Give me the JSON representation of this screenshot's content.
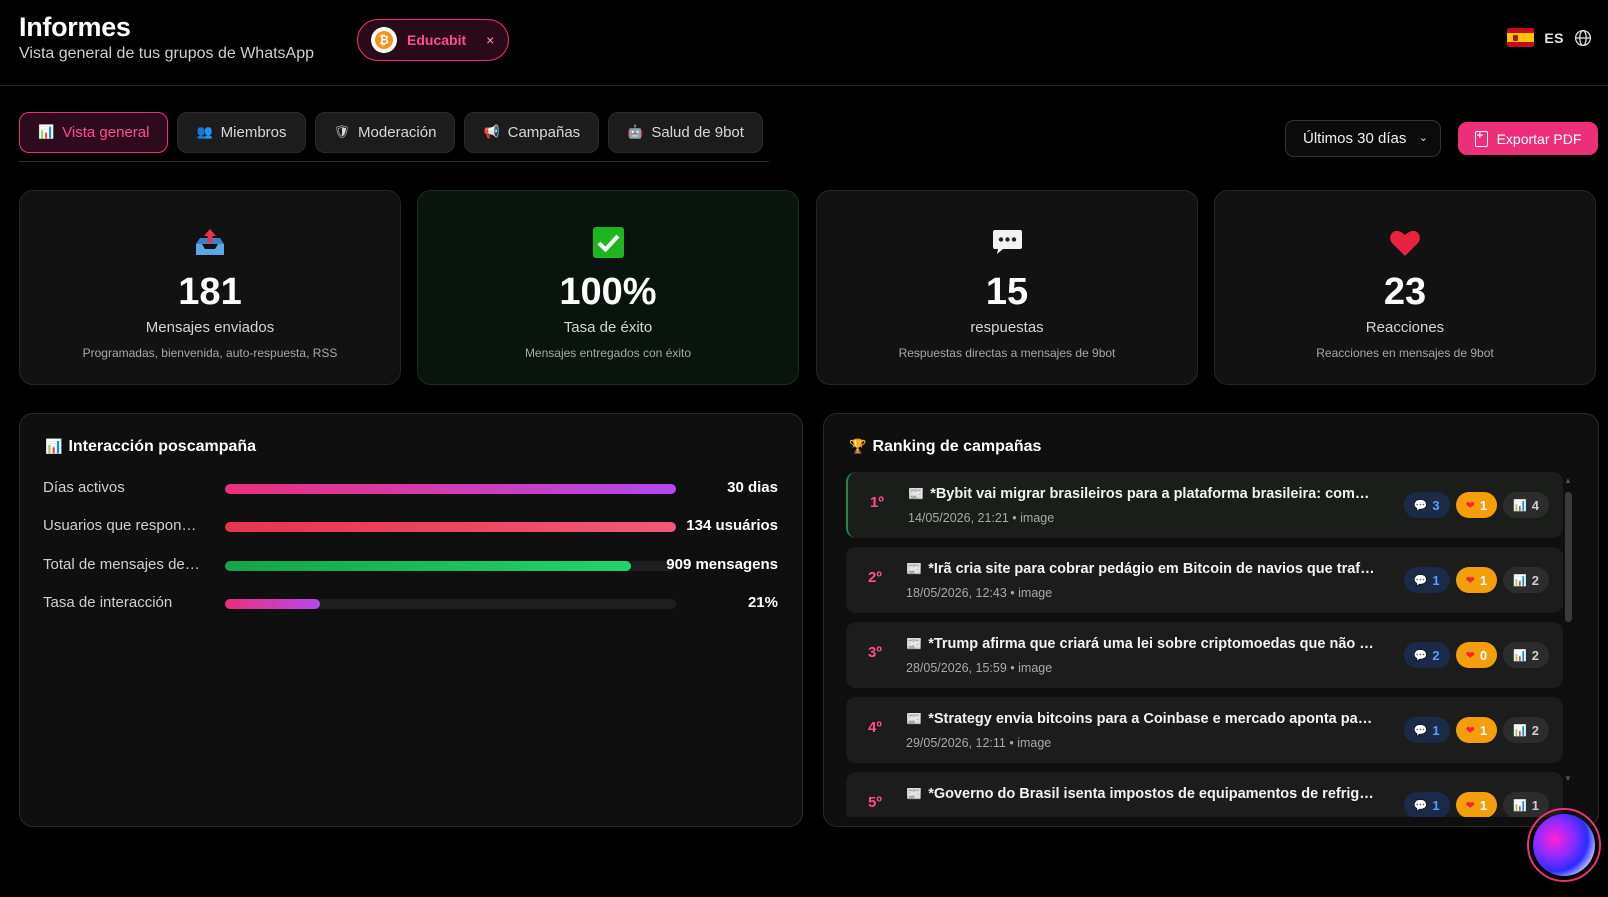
{
  "header": {
    "title": "Informes",
    "subtitle": "Vista general de tus grupos de WhatsApp",
    "group_chip": {
      "name": "Educabit",
      "close": "×",
      "avatar_glyph": "₿"
    },
    "language": {
      "code": "ES",
      "flag": "spain-flag",
      "icon": "globe-icon"
    }
  },
  "tabs": [
    {
      "label": "Vista general",
      "icon": "📊",
      "active": true
    },
    {
      "label": "Miembros",
      "icon": "👥",
      "active": false
    },
    {
      "label": "Moderación",
      "icon": "🛡",
      "active": false
    },
    {
      "label": "Campañas",
      "icon": "📢",
      "active": false
    },
    {
      "label": "Salud de 9bot",
      "icon": "🤖",
      "active": false
    }
  ],
  "toolbar": {
    "range_select": {
      "value": "Últimos 30 días",
      "chevron": "⌄"
    },
    "export_label": "Exportar PDF"
  },
  "stats": [
    {
      "icon": "outbox-tray-icon",
      "value": "181",
      "label": "Mensajes enviados",
      "description": "Programadas, bienvenida, auto-respuesta, RSS"
    },
    {
      "icon": "check-mark-icon",
      "value": "100%",
      "label": "Tasa de éxito",
      "description": "Mensajes entregados con éxito"
    },
    {
      "icon": "speech-bubble-icon",
      "value": "15",
      "label": "respuestas",
      "description": "Respuestas directas a mensajes de 9bot"
    },
    {
      "icon": "heart-icon",
      "value": "23",
      "label": "Reacciones",
      "description": "Reacciones en mensajes de 9bot"
    }
  ],
  "engagement": {
    "title": "Interacción poscampaña",
    "icon": "📊",
    "metrics": [
      {
        "label": "Días activos",
        "value": "30 dias",
        "fill": 1.0,
        "gradient": [
          "#ec2f78",
          "#b548f0"
        ]
      },
      {
        "label": "Usuarios que responden",
        "value": "134 usuários",
        "fill": 1.0,
        "gradient": [
          "#e8334f",
          "#f2587a"
        ]
      },
      {
        "label": "Total de mensajes del grupo",
        "value": "909 mensagens",
        "fill": 0.9,
        "gradient": [
          "#16a34a",
          "#22d36e"
        ]
      },
      {
        "label": "Tasa de interacción",
        "value": "21%",
        "fill": 0.21,
        "gradient": [
          "#ec2f78",
          "#b548f0"
        ]
      }
    ]
  },
  "ranking": {
    "title": "Ranking de campañas",
    "icon": "🏆",
    "items": [
      {
        "pos": "1º",
        "title": "*Bybit vai migrar brasileiros para a plataforma brasileira: como vai funcionar*",
        "date": "14/05/2026, 21:21",
        "type": "image",
        "replies": "3",
        "reactions": "1",
        "stats": "4"
      },
      {
        "pos": "2º",
        "title": "*Irã cria site para cobrar pedágio em Bitcoin de navios que trafegam*",
        "date": "18/05/2026, 12:43",
        "type": "image",
        "replies": "1",
        "reactions": "1",
        "stats": "2"
      },
      {
        "pos": "3º",
        "title": "*Trump afirma que criará uma lei sobre criptomoedas que não existe*",
        "date": "28/05/2026, 15:59",
        "type": "image",
        "replies": "2",
        "reactions": "0",
        "stats": "2"
      },
      {
        "pos": "4º",
        "title": "*Strategy envia bitcoins para a Coinbase e mercado aponta para venda*",
        "date": "29/05/2026, 12:11",
        "type": "image",
        "replies": "1",
        "reactions": "1",
        "stats": "2"
      },
      {
        "pos": "5º",
        "title": "*Governo do Brasil isenta impostos de equipamentos de refrigeração*",
        "date": "",
        "type": "",
        "replies": "1",
        "reactions": "1",
        "stats": "1"
      }
    ]
  }
}
